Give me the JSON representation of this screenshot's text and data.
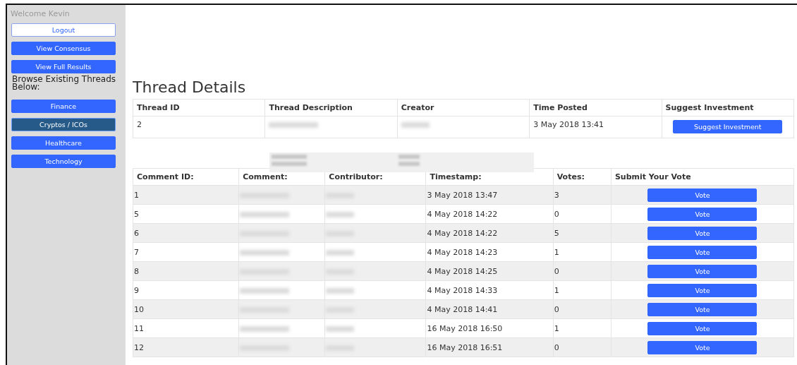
{
  "sidebar": {
    "welcome": "Welcome Kevin",
    "logout": "Logout",
    "actions": [
      "View Consensus",
      "View Full Results"
    ],
    "browse_label": "Browse Existing Threads Below:",
    "categories": [
      {
        "label": "Finance",
        "selected": false
      },
      {
        "label": "Cryptos / ICOs",
        "selected": true
      },
      {
        "label": "Healthcare",
        "selected": false
      },
      {
        "label": "Technology",
        "selected": false
      }
    ]
  },
  "heading": "Thread Details",
  "thread_table": {
    "columns": [
      "Thread ID",
      "Thread Description",
      "Creator",
      "Time Posted",
      "Suggest Investment"
    ],
    "row": {
      "id": "2",
      "time": "3 May 2018 13:41",
      "button": "Suggest Investment"
    }
  },
  "comments_table": {
    "columns": [
      "Comment ID:",
      "Comment:",
      "Contributor:",
      "Timestamp:",
      "Votes:",
      "Submit Your Vote"
    ],
    "rows": [
      {
        "id": "1",
        "timestamp": "3 May 2018 13:47",
        "votes": "3",
        "button": "Vote"
      },
      {
        "id": "5",
        "timestamp": "4 May 2018 14:22",
        "votes": "0",
        "button": "Vote"
      },
      {
        "id": "6",
        "timestamp": "4 May 2018 14:22",
        "votes": "5",
        "button": "Vote"
      },
      {
        "id": "7",
        "timestamp": "4 May 2018 14:23",
        "votes": "1",
        "button": "Vote"
      },
      {
        "id": "8",
        "timestamp": "4 May 2018 14:25",
        "votes": "0",
        "button": "Vote"
      },
      {
        "id": "9",
        "timestamp": "4 May 2018 14:33",
        "votes": "1",
        "button": "Vote"
      },
      {
        "id": "10",
        "timestamp": "4 May 2018 14:41",
        "votes": "0",
        "button": "Vote"
      },
      {
        "id": "11",
        "timestamp": "16 May 2018 16:50",
        "votes": "1",
        "button": "Vote"
      },
      {
        "id": "12",
        "timestamp": "16 May 2018 16:51",
        "votes": "0",
        "button": "Vote"
      }
    ]
  }
}
